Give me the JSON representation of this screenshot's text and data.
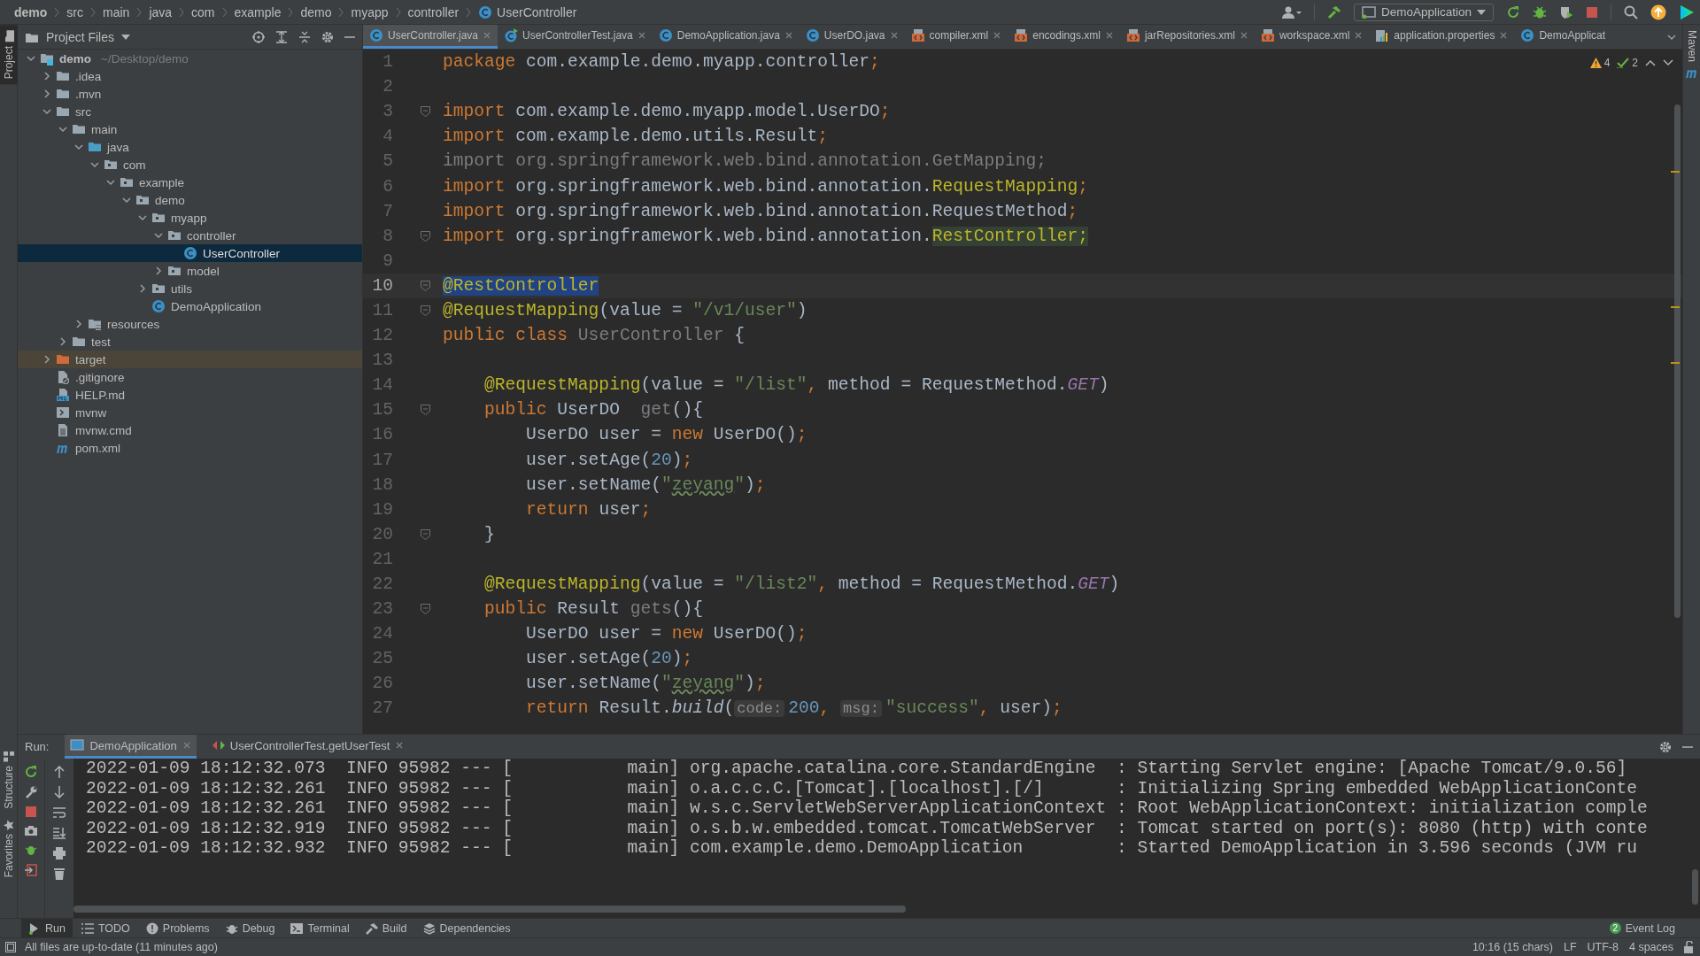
{
  "breadcrumb": [
    {
      "label": "demo",
      "kind": "project"
    },
    {
      "label": "src",
      "kind": "dir"
    },
    {
      "label": "main",
      "kind": "dir"
    },
    {
      "label": "java",
      "kind": "dir"
    },
    {
      "label": "com",
      "kind": "dir"
    },
    {
      "label": "example",
      "kind": "dir"
    },
    {
      "label": "demo",
      "kind": "dir"
    },
    {
      "label": "myapp",
      "kind": "dir"
    },
    {
      "label": "controller",
      "kind": "dir"
    },
    {
      "label": "UserController",
      "kind": "class"
    }
  ],
  "toolbar": {
    "run_configuration": "DemoApplication"
  },
  "side_tabs": {
    "left_top": [
      {
        "label": "Project",
        "selected": true
      }
    ],
    "left_bottom": [
      {
        "label": "Structure",
        "selected": false
      },
      {
        "label": "Favorites",
        "selected": false
      }
    ],
    "right": [
      {
        "label": "Maven",
        "selected": false
      }
    ]
  },
  "project": {
    "title": "Project Files",
    "tree": [
      {
        "label": "demo",
        "path": "~/Desktop/demo",
        "kind": "project",
        "expanded": true,
        "selected": false,
        "children": [
          {
            "label": ".idea",
            "kind": "folder",
            "expanded": false,
            "selected": false
          },
          {
            "label": ".mvn",
            "kind": "folder",
            "expanded": false,
            "selected": false
          },
          {
            "label": "src",
            "kind": "folder",
            "expanded": true,
            "selected": false,
            "children": [
              {
                "label": "main",
                "kind": "folder",
                "expanded": true,
                "selected": false,
                "children": [
                  {
                    "label": "java",
                    "kind": "source",
                    "expanded": true,
                    "selected": false,
                    "children": [
                      {
                        "label": "com",
                        "kind": "package",
                        "expanded": true,
                        "selected": false,
                        "children": [
                          {
                            "label": "example",
                            "kind": "package",
                            "expanded": true,
                            "selected": false,
                            "children": [
                              {
                                "label": "demo",
                                "kind": "package",
                                "expanded": true,
                                "selected": false,
                                "children": [
                                  {
                                    "label": "myapp",
                                    "kind": "package",
                                    "expanded": true,
                                    "selected": false,
                                    "children": [
                                      {
                                        "label": "controller",
                                        "kind": "package",
                                        "expanded": true,
                                        "selected": false,
                                        "children": [
                                          {
                                            "label": "UserController",
                                            "kind": "class",
                                            "selected": true
                                          }
                                        ]
                                      },
                                      {
                                        "label": "model",
                                        "kind": "package",
                                        "expanded": false,
                                        "selected": false
                                      }
                                    ]
                                  },
                                  {
                                    "label": "utils",
                                    "kind": "package",
                                    "expanded": false,
                                    "selected": false
                                  },
                                  {
                                    "label": "DemoApplication",
                                    "kind": "class",
                                    "selected": false
                                  }
                                ]
                              }
                            ]
                          }
                        ]
                      }
                    ]
                  },
                  {
                    "label": "resources",
                    "kind": "resources",
                    "expanded": false,
                    "selected": false
                  }
                ]
              },
              {
                "label": "test",
                "kind": "folder",
                "expanded": false,
                "selected": false
              }
            ]
          },
          {
            "label": "target",
            "kind": "excluded",
            "expanded": false,
            "selected": false
          },
          {
            "label": ".gitignore",
            "kind": "ignore",
            "selected": false
          },
          {
            "label": "HELP.md",
            "kind": "markdown",
            "selected": false
          },
          {
            "label": "mvnw",
            "kind": "script",
            "selected": false
          },
          {
            "label": "mvnw.cmd",
            "kind": "text",
            "selected": false
          },
          {
            "label": "pom.xml",
            "kind": "maven",
            "selected": false
          }
        ]
      }
    ]
  },
  "editor": {
    "tabs": [
      {
        "label": "UserController.java",
        "kind": "class",
        "selected": true
      },
      {
        "label": "UserControllerTest.java",
        "kind": "test",
        "selected": false
      },
      {
        "label": "DemoApplication.java",
        "kind": "class",
        "selected": false
      },
      {
        "label": "UserDO.java",
        "kind": "class",
        "selected": false
      },
      {
        "label": "compiler.xml",
        "kind": "xml",
        "selected": false
      },
      {
        "label": "encodings.xml",
        "kind": "xml",
        "selected": false
      },
      {
        "label": "jarRepositories.xml",
        "kind": "xml",
        "selected": false
      },
      {
        "label": "workspace.xml",
        "kind": "xml",
        "selected": false
      },
      {
        "label": "application.properties",
        "kind": "properties",
        "selected": false
      },
      {
        "label": "DemoApplicat",
        "kind": "class",
        "selected": false
      }
    ],
    "inspections": {
      "warnings": "4",
      "weak_warnings": "2"
    },
    "lines": [
      {
        "number": "1",
        "current": false,
        "fold": false,
        "tokens": [
          {
            "kind": "keyword",
            "text": "package"
          },
          {
            "kind": "plain",
            "text": " com.example.demo.myapp.controller"
          },
          {
            "kind": "keyword",
            "text": ";"
          }
        ]
      },
      {
        "number": "2",
        "current": false,
        "fold": false
      },
      {
        "number": "3",
        "current": false,
        "fold": true,
        "tokens": [
          {
            "kind": "keyword",
            "text": "import"
          },
          {
            "kind": "plain",
            "text": " com.example.demo.myapp.model.UserDO"
          },
          {
            "kind": "keyword",
            "text": ";"
          }
        ]
      },
      {
        "number": "4",
        "current": false,
        "fold": false,
        "tokens": [
          {
            "kind": "keyword",
            "text": "import"
          },
          {
            "kind": "plain",
            "text": " com.example.demo.utils.Result"
          },
          {
            "kind": "keyword",
            "text": ";"
          }
        ]
      },
      {
        "number": "5",
        "current": false,
        "fold": false,
        "tokens": [
          {
            "kind": "unused",
            "text": "import org.springframework.web.bind.annotation.GetMapping;"
          }
        ]
      },
      {
        "number": "6",
        "current": false,
        "fold": false,
        "tokens": [
          {
            "kind": "keyword",
            "text": "import"
          },
          {
            "kind": "plain",
            "text": " org.springframework.web.bind.annotation."
          },
          {
            "kind": "annotation",
            "text": "RequestMapping"
          },
          {
            "kind": "keyword",
            "text": ";"
          }
        ]
      },
      {
        "number": "7",
        "current": false,
        "fold": false,
        "tokens": [
          {
            "kind": "keyword",
            "text": "import"
          },
          {
            "kind": "plain",
            "text": " org.springframework.web.bind.annotation.RequestMethod"
          },
          {
            "kind": "keyword",
            "text": ";"
          }
        ]
      },
      {
        "number": "8",
        "current": false,
        "fold": true,
        "tokens": [
          {
            "kind": "keyword",
            "text": "import"
          },
          {
            "kind": "plain",
            "text": " org.springframework.web.bind.annotation."
          },
          {
            "kind": "usage",
            "text": "RestController;"
          }
        ]
      },
      {
        "number": "9",
        "current": false,
        "fold": false
      },
      {
        "number": "10",
        "current": true,
        "fold": true,
        "tokens": [
          {
            "kind": "selection",
            "text": "@RestController"
          }
        ]
      },
      {
        "number": "11",
        "current": false,
        "fold": true,
        "tokens": [
          {
            "kind": "annotation",
            "text": "@RequestMapping"
          },
          {
            "kind": "plain",
            "text": "(value = "
          },
          {
            "kind": "string",
            "text": "\"/v1/user\""
          },
          {
            "kind": "plain",
            "text": ")"
          }
        ]
      },
      {
        "number": "12",
        "current": false,
        "fold": false,
        "tokens": [
          {
            "kind": "keyword",
            "text": "public class "
          },
          {
            "kind": "unused",
            "text": "UserController"
          },
          {
            "kind": "plain",
            "text": " {"
          }
        ]
      },
      {
        "number": "13",
        "current": false,
        "fold": false
      },
      {
        "number": "14",
        "current": false,
        "fold": false,
        "tokens": [
          {
            "kind": "annotation",
            "text": "    @RequestMapping"
          },
          {
            "kind": "plain",
            "text": "(value = "
          },
          {
            "kind": "string",
            "text": "\"/list\""
          },
          {
            "kind": "keyword",
            "text": ", "
          },
          {
            "kind": "plain",
            "text": "method = RequestMethod."
          },
          {
            "kind": "constant",
            "text": "GET"
          },
          {
            "kind": "plain",
            "text": ")"
          }
        ]
      },
      {
        "number": "15",
        "current": false,
        "fold": true,
        "tokens": [
          {
            "kind": "keyword",
            "text": "    public "
          },
          {
            "kind": "plain",
            "text": "UserDO  "
          },
          {
            "kind": "unused",
            "text": "get"
          },
          {
            "kind": "plain",
            "text": "(){"
          }
        ]
      },
      {
        "number": "16",
        "current": false,
        "fold": false,
        "tokens": [
          {
            "kind": "plain",
            "text": "        UserDO user = "
          },
          {
            "kind": "keyword",
            "text": "new "
          },
          {
            "kind": "plain",
            "text": "UserDO()"
          },
          {
            "kind": "keyword",
            "text": ";"
          }
        ]
      },
      {
        "number": "17",
        "current": false,
        "fold": false,
        "tokens": [
          {
            "kind": "plain",
            "text": "        user.setAge("
          },
          {
            "kind": "number",
            "text": "20"
          },
          {
            "kind": "plain",
            "text": ")"
          },
          {
            "kind": "keyword",
            "text": ";"
          }
        ]
      },
      {
        "number": "18",
        "current": false,
        "fold": false,
        "tokens": [
          {
            "kind": "plain",
            "text": "        user.setName("
          },
          {
            "kind": "string",
            "text": "\""
          },
          {
            "kind": "typo",
            "text": "zeyang"
          },
          {
            "kind": "string",
            "text": "\""
          },
          {
            "kind": "plain",
            "text": ")"
          },
          {
            "kind": "keyword",
            "text": ";"
          }
        ]
      },
      {
        "number": "19",
        "current": false,
        "fold": false,
        "tokens": [
          {
            "kind": "keyword",
            "text": "        return "
          },
          {
            "kind": "plain",
            "text": "user"
          },
          {
            "kind": "keyword",
            "text": ";"
          }
        ]
      },
      {
        "number": "20",
        "current": false,
        "fold": true,
        "tokens": [
          {
            "kind": "plain",
            "text": "    }"
          }
        ]
      },
      {
        "number": "21",
        "current": false,
        "fold": false
      },
      {
        "number": "22",
        "current": false,
        "fold": false,
        "tokens": [
          {
            "kind": "annotation",
            "text": "    @RequestMapping"
          },
          {
            "kind": "plain",
            "text": "(value = "
          },
          {
            "kind": "string",
            "text": "\"/list2\""
          },
          {
            "kind": "keyword",
            "text": ", "
          },
          {
            "kind": "plain",
            "text": "method = RequestMethod."
          },
          {
            "kind": "constant",
            "text": "GET"
          },
          {
            "kind": "plain",
            "text": ")"
          }
        ]
      },
      {
        "number": "23",
        "current": false,
        "fold": true,
        "tokens": [
          {
            "kind": "keyword",
            "text": "    public "
          },
          {
            "kind": "plain",
            "text": "Result "
          },
          {
            "kind": "unused",
            "text": "gets"
          },
          {
            "kind": "plain",
            "text": "(){"
          }
        ]
      },
      {
        "number": "24",
        "current": false,
        "fold": false,
        "tokens": [
          {
            "kind": "plain",
            "text": "        UserDO user = "
          },
          {
            "kind": "keyword",
            "text": "new "
          },
          {
            "kind": "plain",
            "text": "UserDO()"
          },
          {
            "kind": "keyword",
            "text": ";"
          }
        ]
      },
      {
        "number": "25",
        "current": false,
        "fold": false,
        "tokens": [
          {
            "kind": "plain",
            "text": "        user.setAge("
          },
          {
            "kind": "number",
            "text": "20"
          },
          {
            "kind": "plain",
            "text": ")"
          },
          {
            "kind": "keyword",
            "text": ";"
          }
        ]
      },
      {
        "number": "26",
        "current": false,
        "fold": false,
        "tokens": [
          {
            "kind": "plain",
            "text": "        user.setName("
          },
          {
            "kind": "string",
            "text": "\""
          },
          {
            "kind": "typo",
            "text": "zeyang"
          },
          {
            "kind": "string",
            "text": "\""
          },
          {
            "kind": "plain",
            "text": ")"
          },
          {
            "kind": "keyword",
            "text": ";"
          }
        ]
      },
      {
        "number": "27",
        "current": false,
        "fold": false,
        "tokens": [
          {
            "kind": "keyword",
            "text": "        return "
          },
          {
            "kind": "plain",
            "text": "Result."
          },
          {
            "kind": "static",
            "text": "build"
          },
          {
            "kind": "plain",
            "text": "("
          },
          {
            "kind": "hint",
            "text": "code:"
          },
          {
            "kind": "number",
            "text": "200"
          },
          {
            "kind": "keyword",
            "text": ", "
          },
          {
            "kind": "hint",
            "text": "msg:"
          },
          {
            "kind": "string",
            "text": "\"success\""
          },
          {
            "kind": "keyword",
            "text": ", "
          },
          {
            "kind": "plain",
            "text": "user)"
          },
          {
            "kind": "keyword",
            "text": ";"
          }
        ]
      }
    ]
  },
  "run": {
    "label": "Run:",
    "tabs": [
      {
        "label": "DemoApplication",
        "kind": "app",
        "selected": true
      },
      {
        "label": "UserControllerTest.getUserTest",
        "kind": "test",
        "selected": false
      }
    ],
    "log": [
      "2022-01-09 18:12:32.073  INFO 95982 --- [           main] org.apache.catalina.core.StandardEngine  : Starting Servlet engine: [Apache Tomcat/9.0.56]",
      "2022-01-09 18:12:32.261  INFO 95982 --- [           main] o.a.c.c.C.[Tomcat].[localhost].[/]       : Initializing Spring embedded WebApplicationConte",
      "2022-01-09 18:12:32.261  INFO 95982 --- [           main] w.s.c.ServletWebServerApplicationContext : Root WebApplicationContext: initialization comple",
      "2022-01-09 18:12:32.919  INFO 95982 --- [           main] o.s.b.w.embedded.tomcat.TomcatWebServer  : Tomcat started on port(s): 8080 (http) with conte",
      "2022-01-09 18:12:32.932  INFO 95982 --- [           main] com.example.demo.DemoApplication         : Started DemoApplication in 3.596 seconds (JVM ru"
    ]
  },
  "tool_windows": [
    {
      "label": "Run",
      "kind": "run",
      "selected": true
    },
    {
      "label": "TODO",
      "kind": "todo",
      "selected": false
    },
    {
      "label": "Problems",
      "kind": "problems",
      "selected": false
    },
    {
      "label": "Debug",
      "kind": "debug",
      "selected": false
    },
    {
      "label": "Terminal",
      "kind": "terminal",
      "selected": false
    },
    {
      "label": "Build",
      "kind": "build",
      "selected": false
    },
    {
      "label": "Dependencies",
      "kind": "dependencies",
      "selected": false
    }
  ],
  "event_log": {
    "label": "Event Log",
    "count": "2"
  },
  "status_bar": {
    "message": "All files are up-to-date (11 minutes ago)",
    "position": "10:16 (15 chars)",
    "line_separator": "LF",
    "encoding": "UTF-8",
    "indent": "4 spaces"
  }
}
